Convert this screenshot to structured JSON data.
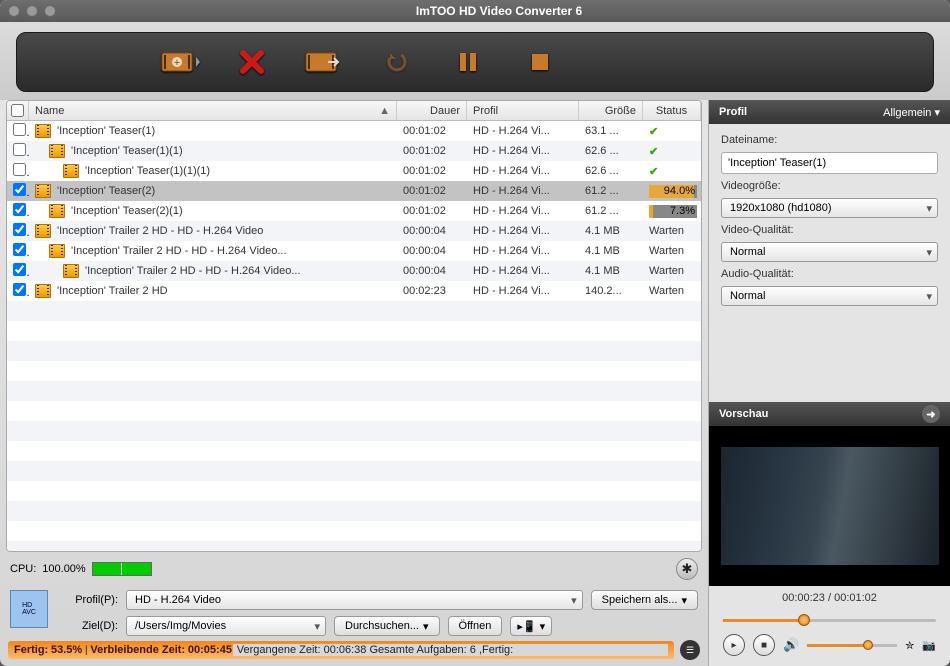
{
  "title": "ImTOO HD Video Converter 6",
  "columns": {
    "name": "Name",
    "dauer": "Dauer",
    "profil": "Profil",
    "groesse": "Größe",
    "status": "Status"
  },
  "rows": [
    {
      "checked": false,
      "indent": 0,
      "name": "'Inception' Teaser(1)",
      "dur": "00:01:02",
      "prof": "HD - H.264 Vi...",
      "size": "63.1 ...",
      "status": {
        "type": "done"
      }
    },
    {
      "checked": false,
      "indent": 1,
      "name": "'Inception' Teaser(1)(1)",
      "dur": "00:01:02",
      "prof": "HD - H.264 Vi...",
      "size": "62.6 ...",
      "status": {
        "type": "done"
      }
    },
    {
      "checked": false,
      "indent": 2,
      "name": "'Inception' Teaser(1)(1)(1)",
      "dur": "00:01:02",
      "prof": "HD - H.264 Vi...",
      "size": "62.6 ...",
      "status": {
        "type": "done"
      }
    },
    {
      "checked": true,
      "indent": 0,
      "name": "'Inception' Teaser(2)",
      "dur": "00:01:02",
      "prof": "HD - H.264 Vi...",
      "size": "61.2 ...",
      "status": {
        "type": "progress",
        "pct": 94.0
      },
      "selected": true
    },
    {
      "checked": true,
      "indent": 1,
      "name": "'Inception' Teaser(2)(1)",
      "dur": "00:01:02",
      "prof": "HD - H.264 Vi...",
      "size": "61.2 ...",
      "status": {
        "type": "progress",
        "pct": 7.3
      }
    },
    {
      "checked": true,
      "indent": 0,
      "name": "'Inception' Trailer 2 HD - HD - H.264 Video",
      "dur": "00:00:04",
      "prof": "HD - H.264 Vi...",
      "size": "4.1 MB",
      "status": {
        "type": "wait"
      }
    },
    {
      "checked": true,
      "indent": 1,
      "name": "'Inception' Trailer 2 HD - HD - H.264 Video...",
      "dur": "00:00:04",
      "prof": "HD - H.264 Vi...",
      "size": "4.1 MB",
      "status": {
        "type": "wait"
      }
    },
    {
      "checked": true,
      "indent": 2,
      "name": "'Inception' Trailer 2 HD - HD - H.264 Video...",
      "dur": "00:00:04",
      "prof": "HD - H.264 Vi...",
      "size": "4.1 MB",
      "status": {
        "type": "wait"
      }
    },
    {
      "checked": true,
      "indent": 0,
      "name": "'Inception' Trailer 2 HD",
      "dur": "00:02:23",
      "prof": "HD - H.264 Vi...",
      "size": "140.2...",
      "status": {
        "type": "wait"
      }
    }
  ],
  "statusWait": "Warten",
  "cpu": {
    "label": "CPU:",
    "value": "100.00%"
  },
  "opts": {
    "profilLabel": "Profil(P):",
    "profilValue": "HD - H.264 Video",
    "speichern": "Speichern als...",
    "zielLabel": "Ziel(D):",
    "zielValue": "/Users/Img/Movies",
    "durchsuchen": "Durchsuchen...",
    "oeffnen": "Öffnen"
  },
  "statusStrip": {
    "fertig": "Fertig:",
    "pct": "53.5%",
    "verbl": "Verbleibende Zeit:",
    "verblVal": "00:05:45",
    "verg": "Vergangene Zeit:",
    "vergVal": "00:06:38",
    "ges": "Gesamte Aufgaben:",
    "gesVal": "6",
    "fertigLbl": ",Fertig:"
  },
  "profil": {
    "header": "Profil",
    "allgemein": "Allgemein",
    "dateiname": "Dateiname:",
    "dateinameVal": "'Inception' Teaser(1)",
    "videogroesse": "Videogröße:",
    "videogroesseVal": "1920x1080 (hd1080)",
    "vq": "Video-Qualität:",
    "vqVal": "Normal",
    "aq": "Audio-Qualität:",
    "aqVal": "Normal"
  },
  "vorschau": {
    "header": "Vorschau",
    "time": "00:00:23 / 00:01:02",
    "progress": 38
  }
}
